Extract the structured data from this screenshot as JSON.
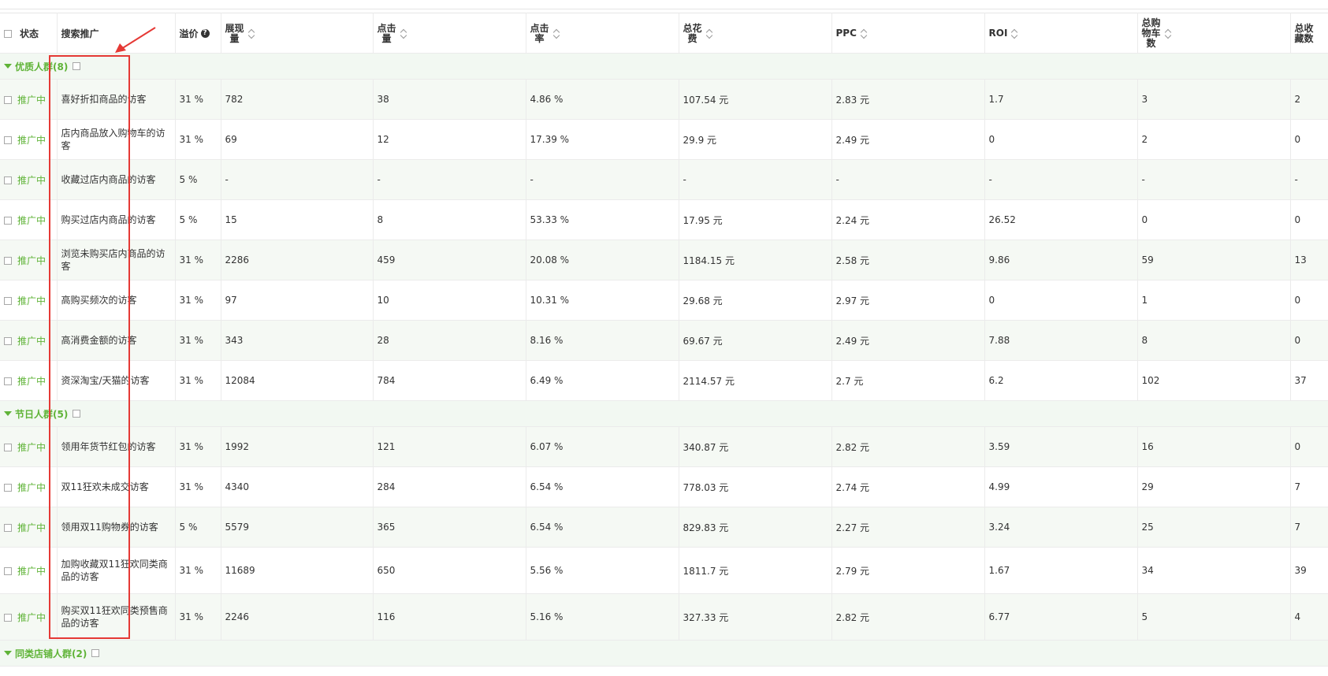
{
  "headers": {
    "status": "状态",
    "name": "搜索推广",
    "premium": "溢价",
    "impressions": "展现\n量",
    "clicks": "点击\n量",
    "ctr": "点击\n率",
    "cost": "总花\n费",
    "ppc": "PPC",
    "roi": "ROI",
    "cart": "总购\n物车\n数",
    "fav": "总收\n藏数"
  },
  "icons": {
    "help": "question-circle-icon",
    "sort": "sort-icon",
    "expand": "caret-down-icon",
    "checkbox": "checkbox-icon"
  },
  "colors": {
    "accent": "#5fb337",
    "annotation": "#e53935",
    "row_alt": "#f5f9f4",
    "group_bg": "#f2f8f2"
  },
  "groups": [
    {
      "label": "优质人群(8)",
      "rows": [
        {
          "status": "推广中",
          "name": "喜好折扣商品的访客",
          "premium": "31 %",
          "impressions": "782",
          "clicks": "38",
          "ctr": "4.86 %",
          "cost": "107.54 元",
          "ppc": "2.83 元",
          "roi": "1.7",
          "cart": "3",
          "fav": "2"
        },
        {
          "status": "推广中",
          "name": "店内商品放入购物车的访客",
          "premium": "31 %",
          "impressions": "69",
          "clicks": "12",
          "ctr": "17.39 %",
          "cost": "29.9 元",
          "ppc": "2.49 元",
          "roi": "0",
          "cart": "2",
          "fav": "0"
        },
        {
          "status": "推广中",
          "name": "收藏过店内商品的访客",
          "premium": "5 %",
          "impressions": "-",
          "clicks": "-",
          "ctr": "-",
          "cost": "-",
          "ppc": "-",
          "roi": "-",
          "cart": "-",
          "fav": "-"
        },
        {
          "status": "推广中",
          "name": "购买过店内商品的访客",
          "premium": "5 %",
          "impressions": "15",
          "clicks": "8",
          "ctr": "53.33 %",
          "cost": "17.95 元",
          "ppc": "2.24 元",
          "roi": "26.52",
          "cart": "0",
          "fav": "0"
        },
        {
          "status": "推广中",
          "name": "浏览未购买店内商品的访客",
          "premium": "31 %",
          "impressions": "2286",
          "clicks": "459",
          "ctr": "20.08 %",
          "cost": "1184.15 元",
          "ppc": "2.58 元",
          "roi": "9.86",
          "cart": "59",
          "fav": "13"
        },
        {
          "status": "推广中",
          "name": "高购买频次的访客",
          "premium": "31 %",
          "impressions": "97",
          "clicks": "10",
          "ctr": "10.31 %",
          "cost": "29.68 元",
          "ppc": "2.97 元",
          "roi": "0",
          "cart": "1",
          "fav": "0"
        },
        {
          "status": "推广中",
          "name": "高消费金额的访客",
          "premium": "31 %",
          "impressions": "343",
          "clicks": "28",
          "ctr": "8.16 %",
          "cost": "69.67 元",
          "ppc": "2.49 元",
          "roi": "7.88",
          "cart": "8",
          "fav": "0"
        },
        {
          "status": "推广中",
          "name": "资深淘宝/天猫的访客",
          "premium": "31 %",
          "impressions": "12084",
          "clicks": "784",
          "ctr": "6.49 %",
          "cost": "2114.57 元",
          "ppc": "2.7 元",
          "roi": "6.2",
          "cart": "102",
          "fav": "37"
        }
      ]
    },
    {
      "label": "节日人群(5)",
      "rows": [
        {
          "status": "推广中",
          "name": "领用年货节红包的访客",
          "premium": "31 %",
          "impressions": "1992",
          "clicks": "121",
          "ctr": "6.07 %",
          "cost": "340.87 元",
          "ppc": "2.82 元",
          "roi": "3.59",
          "cart": "16",
          "fav": "0"
        },
        {
          "status": "推广中",
          "name": "双11狂欢未成交访客",
          "premium": "31 %",
          "impressions": "4340",
          "clicks": "284",
          "ctr": "6.54 %",
          "cost": "778.03 元",
          "ppc": "2.74 元",
          "roi": "4.99",
          "cart": "29",
          "fav": "7"
        },
        {
          "status": "推广中",
          "name": "领用双11购物券的访客",
          "premium": "5 %",
          "impressions": "5579",
          "clicks": "365",
          "ctr": "6.54 %",
          "cost": "829.83 元",
          "ppc": "2.27 元",
          "roi": "3.24",
          "cart": "25",
          "fav": "7"
        },
        {
          "status": "推广中",
          "name": "加购收藏双11狂欢同类商品的访客",
          "premium": "31 %",
          "impressions": "11689",
          "clicks": "650",
          "ctr": "5.56 %",
          "cost": "1811.7 元",
          "ppc": "2.79 元",
          "roi": "1.67",
          "cart": "34",
          "fav": "39"
        },
        {
          "status": "推广中",
          "name": "购买双11狂欢同类预售商品的访客",
          "premium": "31 %",
          "impressions": "2246",
          "clicks": "116",
          "ctr": "5.16 %",
          "cost": "327.33 元",
          "ppc": "2.82 元",
          "roi": "6.77",
          "cart": "5",
          "fav": "4"
        }
      ]
    },
    {
      "label": "同类店铺人群(2)",
      "rows": []
    }
  ]
}
